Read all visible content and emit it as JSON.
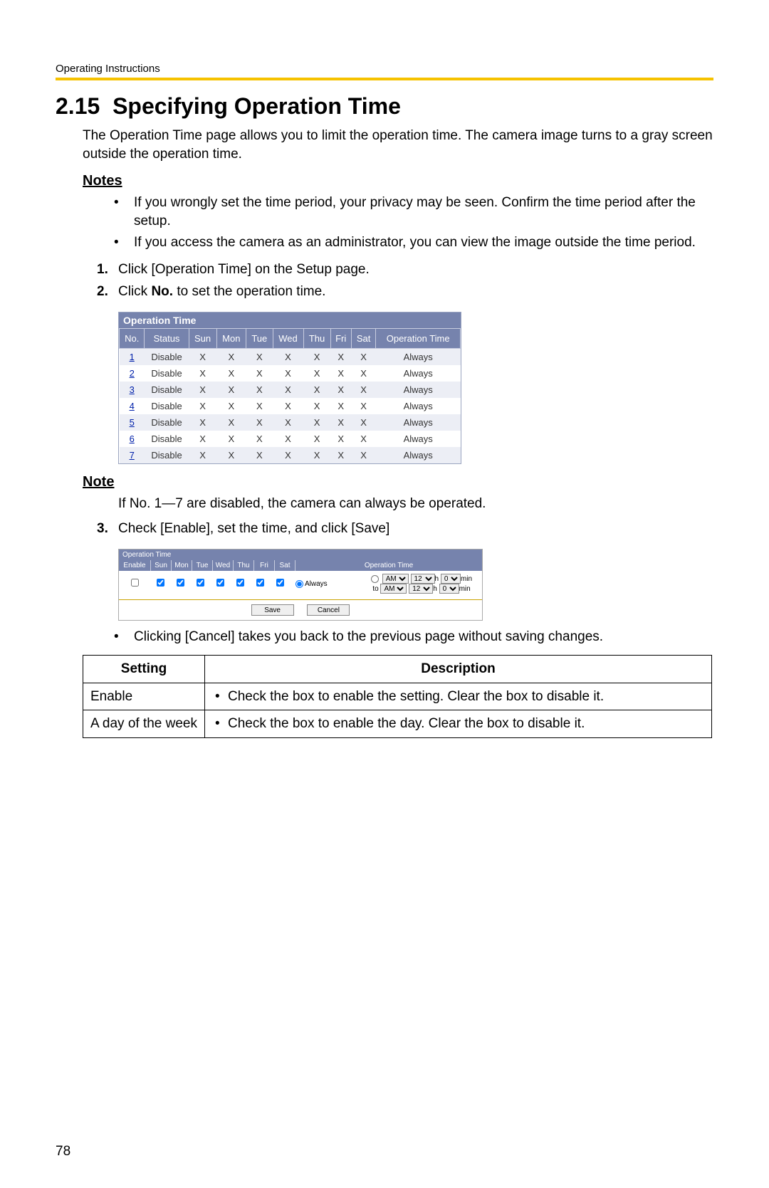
{
  "header": {
    "running": "Operating Instructions"
  },
  "section": {
    "number": "2.15",
    "title": "Specifying Operation Time",
    "intro": "The Operation Time page allows you to limit the operation time. The camera image turns to a gray screen outside the operation time."
  },
  "notes_h": "Notes",
  "notes": [
    "If you wrongly set the time period, your privacy may be seen. Confirm the time period after the setup.",
    "If you access the camera as an administrator, you can view the image outside the time period."
  ],
  "steps": {
    "s1": "Click [Operation Time] on the Setup page.",
    "s2_a": "Click ",
    "s2_b": "No.",
    "s2_c": " to set the operation time.",
    "s3": "Check [Enable], set the time, and click [Save]"
  },
  "ot1": {
    "caption": "Operation Time",
    "cols": [
      "No.",
      "Status",
      "Sun",
      "Mon",
      "Tue",
      "Wed",
      "Thu",
      "Fri",
      "Sat",
      "Operation Time"
    ],
    "rows": [
      {
        "no": "1",
        "status": "Disable",
        "d": [
          "X",
          "X",
          "X",
          "X",
          "X",
          "X",
          "X"
        ],
        "op": "Always"
      },
      {
        "no": "2",
        "status": "Disable",
        "d": [
          "X",
          "X",
          "X",
          "X",
          "X",
          "X",
          "X"
        ],
        "op": "Always"
      },
      {
        "no": "3",
        "status": "Disable",
        "d": [
          "X",
          "X",
          "X",
          "X",
          "X",
          "X",
          "X"
        ],
        "op": "Always"
      },
      {
        "no": "4",
        "status": "Disable",
        "d": [
          "X",
          "X",
          "X",
          "X",
          "X",
          "X",
          "X"
        ],
        "op": "Always"
      },
      {
        "no": "5",
        "status": "Disable",
        "d": [
          "X",
          "X",
          "X",
          "X",
          "X",
          "X",
          "X"
        ],
        "op": "Always"
      },
      {
        "no": "6",
        "status": "Disable",
        "d": [
          "X",
          "X",
          "X",
          "X",
          "X",
          "X",
          "X"
        ],
        "op": "Always"
      },
      {
        "no": "7",
        "status": "Disable",
        "d": [
          "X",
          "X",
          "X",
          "X",
          "X",
          "X",
          "X"
        ],
        "op": "Always"
      }
    ]
  },
  "note2_h": "Note",
  "note2_body": "If No. 1—7 are disabled, the camera can always be operated.",
  "ot2": {
    "caption": "Operation Time",
    "cols": [
      "Enable",
      "Sun",
      "Mon",
      "Tue",
      "Wed",
      "Thu",
      "Fri",
      "Sat",
      "Operation Time"
    ],
    "always": "Always",
    "ampm": "AM",
    "h": "12",
    "m": "0",
    "hlabel": "h",
    "mlabel": "min",
    "to": "to",
    "save": "Save",
    "cancel": "Cancel"
  },
  "cancel_note": "Clicking [Cancel] takes you back to the previous page without saving changes.",
  "desc_table": {
    "h1": "Setting",
    "h2": "Description",
    "r1s": "Enable",
    "r1d": "Check the box to enable the setting. Clear the box to disable it.",
    "r2s": "A day of the week",
    "r2d": "Check the box to enable the day. Clear the box to disable it."
  },
  "page_number": "78"
}
